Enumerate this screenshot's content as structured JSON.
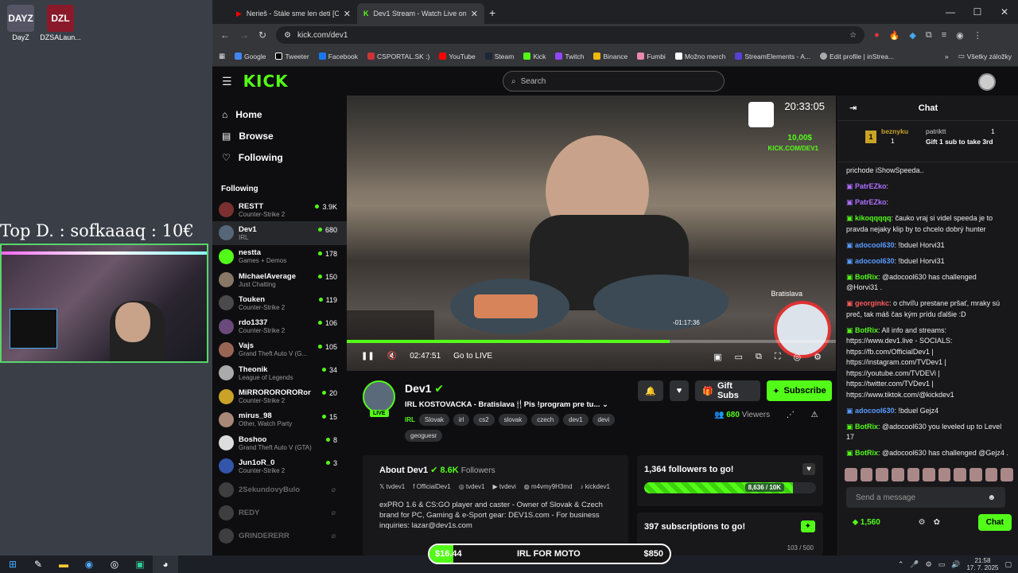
{
  "desktop": {
    "icons": [
      {
        "label": "DayZ",
        "text": "DAYZ"
      },
      {
        "label": "DZSALaun...",
        "text": "DZL"
      }
    ],
    "overlay_text": "Top D. : sofkaaaq : 10€"
  },
  "browser": {
    "tabs": [
      {
        "title": "Nerieš - Stále sme len deti [Off..."
      },
      {
        "title": "Dev1 Stream - Watch Live on Ki..."
      }
    ],
    "url": "kick.com/dev1",
    "bookmarks": [
      "Google",
      "Tweeter",
      "Facebook",
      "CSPORTAL.SK :)",
      "YouTube",
      "Steam",
      "Kick",
      "Twitch",
      "Binance",
      "Fumbi",
      "Možno merch",
      "StreamElements - A...",
      "Edit profile | inStrea..."
    ],
    "all_bookmarks": "Všetky záložky"
  },
  "kick": {
    "logo": "KICK",
    "search_placeholder": "Search",
    "nav": [
      {
        "label": "Home",
        "icon": "home-icon"
      },
      {
        "label": "Browse",
        "icon": "browse-icon"
      },
      {
        "label": "Following",
        "icon": "heart-icon"
      }
    ],
    "following_header": "Following",
    "following": [
      {
        "name": "RESTT",
        "category": "Counter-Strike 2",
        "viewers": "3.9K",
        "color": "#7a3030"
      },
      {
        "name": "Dev1",
        "category": "IRL",
        "viewers": "680",
        "color": "#556677"
      },
      {
        "name": "nestta",
        "category": "Games + Demos",
        "viewers": "178",
        "color": "#53fc18"
      },
      {
        "name": "MichaelAverage",
        "category": "Just Chatting",
        "viewers": "150",
        "color": "#887766"
      },
      {
        "name": "Touken",
        "category": "Counter-Strike 2",
        "viewers": "119",
        "color": "#4a4a4a"
      },
      {
        "name": "rdo1337",
        "category": "Counter-Strike 2",
        "viewers": "106",
        "color": "#6a4a7a"
      },
      {
        "name": "Vajs",
        "category": "Grand Theft Auto V (G...",
        "viewers": "105",
        "color": "#996655"
      },
      {
        "name": "Theonik",
        "category": "League of Legends",
        "viewers": "34",
        "color": "#aaaaaa"
      },
      {
        "name": "MiRRORORORORor",
        "category": "Counter-Strike 2",
        "viewers": "20",
        "color": "#c9a227"
      },
      {
        "name": "mirus_98",
        "category": "Other, Watch Party",
        "viewers": "15",
        "color": "#aa8877"
      },
      {
        "name": "Boshoo",
        "category": "Grand Theft Auto V (GTA)",
        "viewers": "8",
        "color": "#ddd"
      },
      {
        "name": "Jun1oR_0",
        "category": "Counter-Strike 2",
        "viewers": "3",
        "color": "#3355aa"
      }
    ],
    "offline": [
      "2SekundovyBulo",
      "REDY",
      "GRINDERERR"
    ],
    "video": {
      "clock": "20:33:05",
      "money": "10,00$",
      "overlay_brand": "KICK.COM/DEV1",
      "city": "Bratislava",
      "hover_time": "-01:17:36",
      "elapsed": "02:47:51",
      "go_live": "Go to LIVE",
      "progress": 0.66
    },
    "stream": {
      "name": "Dev1",
      "title": "IRL KOSTOVACKA - Bratislava🍴Pis !program pre tu...",
      "category": "IRL",
      "tags": [
        "Slovak",
        "irl",
        "cs2",
        "slovak",
        "czech",
        "dev1",
        "devi",
        "geoguesr"
      ],
      "live": "LIVE",
      "gift_subs": "Gift Subs",
      "subscribe": "Subscribe",
      "viewers": "680",
      "viewers_label": "Viewers"
    },
    "about": {
      "title": "About Dev1",
      "followers": "8.6K",
      "followers_label": "Followers",
      "socials": [
        "tvdev1",
        "OfficialDev1",
        "tvdev1",
        "tvdevi",
        "m4vmy9H3md",
        "kickdev1"
      ],
      "description": "exPRO 1.6 & CS:GO player and caster - Owner of Slovak & Czech brand for PC, Gaming & e-Sport gear: DEV1S.com - For business inquiries: lazar@dev1s.com"
    },
    "goals": [
      {
        "title": "1,364 followers to go!",
        "label": "8,636 / 10K",
        "fraction": 0.8636
      },
      {
        "title": "397 subscriptions to go!",
        "label": "103 / 500",
        "fraction": 0.206
      }
    ],
    "chat": {
      "title": "Chat",
      "pinned": {
        "user": "beznyku",
        "count": "1",
        "rank": "1",
        "user2": "patriktt",
        "count2": "1",
        "text": "Gift 1 sub to take 3rd"
      },
      "messages": [
        {
          "user": "",
          "color": "#eee",
          "text": "prichode iShowSpeeda.."
        },
        {
          "user": "PatrEZko",
          "color": "#b070ff",
          "text": ":"
        },
        {
          "user": "PatrEZko",
          "color": "#b070ff",
          "text": ":"
        },
        {
          "user": "kikoqqqqq",
          "color": "#53fc18",
          "text": ": čauko vraj si videl speeda je to pravda nejaky klip by to chcelo dobrý hunter"
        },
        {
          "user": "adocool630",
          "color": "#5b9bff",
          "text": ": !bduel Horvi31"
        },
        {
          "user": "adocool630",
          "color": "#5b9bff",
          "text": ": !bduel Horvi31"
        },
        {
          "user": "BotRix",
          "color": "#53fc18",
          "text": ": @adocool630 has challenged @Horvi31 ."
        },
        {
          "user": "georginkc",
          "color": "#ff5a5a",
          "text": ": o chvíľu prestane pršať, mraky sú preč, tak máš čas kým prídu ďalšie :D"
        },
        {
          "user": "BotRix",
          "color": "#53fc18",
          "text": ": All info and streams: https://www.dev1.live - SOCIALS: https://fb.com/OfficialDev1 | https://instagram.com/TVDev1 | https://youtube.com/TVDEVi | https://twitter.com/TVDev1 | https://www.tiktok.com/@kickdev1"
        },
        {
          "user": "adocool630",
          "color": "#5b9bff",
          "text": ": !bduel Gejz4"
        },
        {
          "user": "BotRix",
          "color": "#53fc18",
          "text": ": @adocool630 you leveled up to Level 17"
        },
        {
          "user": "BotRix",
          "color": "#53fc18",
          "text": ": @adocool630 has challenged @Gejz4 ."
        }
      ],
      "input_placeholder": "Send a message",
      "points": "1,560",
      "send": "Chat"
    },
    "donation_bar": {
      "current": "$16.44",
      "label": "IRL FOR MOTO",
      "goal": "$850",
      "fraction": 0.0193
    }
  },
  "taskbar": {
    "time": "21:58",
    "date": "17. 7. 2025"
  }
}
